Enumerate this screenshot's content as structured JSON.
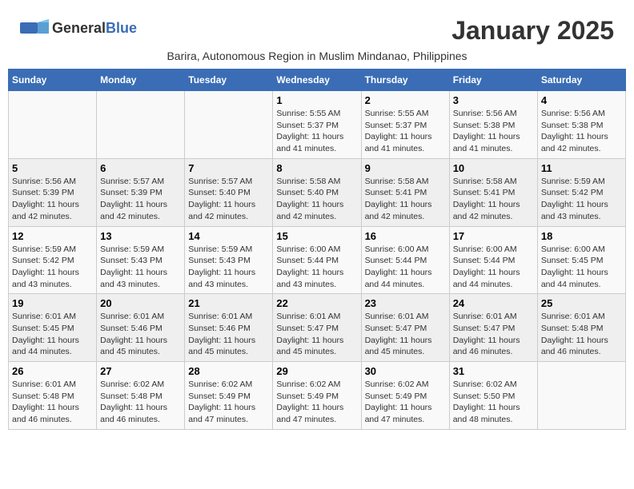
{
  "header": {
    "logo_general": "General",
    "logo_blue": "Blue",
    "month_title": "January 2025",
    "subtitle": "Barira, Autonomous Region in Muslim Mindanao, Philippines"
  },
  "weekdays": [
    "Sunday",
    "Monday",
    "Tuesday",
    "Wednesday",
    "Thursday",
    "Friday",
    "Saturday"
  ],
  "weeks": [
    [
      {
        "day": "",
        "info": ""
      },
      {
        "day": "",
        "info": ""
      },
      {
        "day": "",
        "info": ""
      },
      {
        "day": "1",
        "info": "Sunrise: 5:55 AM\nSunset: 5:37 PM\nDaylight: 11 hours\nand 41 minutes."
      },
      {
        "day": "2",
        "info": "Sunrise: 5:55 AM\nSunset: 5:37 PM\nDaylight: 11 hours\nand 41 minutes."
      },
      {
        "day": "3",
        "info": "Sunrise: 5:56 AM\nSunset: 5:38 PM\nDaylight: 11 hours\nand 41 minutes."
      },
      {
        "day": "4",
        "info": "Sunrise: 5:56 AM\nSunset: 5:38 PM\nDaylight: 11 hours\nand 42 minutes."
      }
    ],
    [
      {
        "day": "5",
        "info": "Sunrise: 5:56 AM\nSunset: 5:39 PM\nDaylight: 11 hours\nand 42 minutes."
      },
      {
        "day": "6",
        "info": "Sunrise: 5:57 AM\nSunset: 5:39 PM\nDaylight: 11 hours\nand 42 minutes."
      },
      {
        "day": "7",
        "info": "Sunrise: 5:57 AM\nSunset: 5:40 PM\nDaylight: 11 hours\nand 42 minutes."
      },
      {
        "day": "8",
        "info": "Sunrise: 5:58 AM\nSunset: 5:40 PM\nDaylight: 11 hours\nand 42 minutes."
      },
      {
        "day": "9",
        "info": "Sunrise: 5:58 AM\nSunset: 5:41 PM\nDaylight: 11 hours\nand 42 minutes."
      },
      {
        "day": "10",
        "info": "Sunrise: 5:58 AM\nSunset: 5:41 PM\nDaylight: 11 hours\nand 42 minutes."
      },
      {
        "day": "11",
        "info": "Sunrise: 5:59 AM\nSunset: 5:42 PM\nDaylight: 11 hours\nand 43 minutes."
      }
    ],
    [
      {
        "day": "12",
        "info": "Sunrise: 5:59 AM\nSunset: 5:42 PM\nDaylight: 11 hours\nand 43 minutes."
      },
      {
        "day": "13",
        "info": "Sunrise: 5:59 AM\nSunset: 5:43 PM\nDaylight: 11 hours\nand 43 minutes."
      },
      {
        "day": "14",
        "info": "Sunrise: 5:59 AM\nSunset: 5:43 PM\nDaylight: 11 hours\nand 43 minutes."
      },
      {
        "day": "15",
        "info": "Sunrise: 6:00 AM\nSunset: 5:44 PM\nDaylight: 11 hours\nand 43 minutes."
      },
      {
        "day": "16",
        "info": "Sunrise: 6:00 AM\nSunset: 5:44 PM\nDaylight: 11 hours\nand 44 minutes."
      },
      {
        "day": "17",
        "info": "Sunrise: 6:00 AM\nSunset: 5:44 PM\nDaylight: 11 hours\nand 44 minutes."
      },
      {
        "day": "18",
        "info": "Sunrise: 6:00 AM\nSunset: 5:45 PM\nDaylight: 11 hours\nand 44 minutes."
      }
    ],
    [
      {
        "day": "19",
        "info": "Sunrise: 6:01 AM\nSunset: 5:45 PM\nDaylight: 11 hours\nand 44 minutes."
      },
      {
        "day": "20",
        "info": "Sunrise: 6:01 AM\nSunset: 5:46 PM\nDaylight: 11 hours\nand 45 minutes."
      },
      {
        "day": "21",
        "info": "Sunrise: 6:01 AM\nSunset: 5:46 PM\nDaylight: 11 hours\nand 45 minutes."
      },
      {
        "day": "22",
        "info": "Sunrise: 6:01 AM\nSunset: 5:47 PM\nDaylight: 11 hours\nand 45 minutes."
      },
      {
        "day": "23",
        "info": "Sunrise: 6:01 AM\nSunset: 5:47 PM\nDaylight: 11 hours\nand 45 minutes."
      },
      {
        "day": "24",
        "info": "Sunrise: 6:01 AM\nSunset: 5:47 PM\nDaylight: 11 hours\nand 46 minutes."
      },
      {
        "day": "25",
        "info": "Sunrise: 6:01 AM\nSunset: 5:48 PM\nDaylight: 11 hours\nand 46 minutes."
      }
    ],
    [
      {
        "day": "26",
        "info": "Sunrise: 6:01 AM\nSunset: 5:48 PM\nDaylight: 11 hours\nand 46 minutes."
      },
      {
        "day": "27",
        "info": "Sunrise: 6:02 AM\nSunset: 5:48 PM\nDaylight: 11 hours\nand 46 minutes."
      },
      {
        "day": "28",
        "info": "Sunrise: 6:02 AM\nSunset: 5:49 PM\nDaylight: 11 hours\nand 47 minutes."
      },
      {
        "day": "29",
        "info": "Sunrise: 6:02 AM\nSunset: 5:49 PM\nDaylight: 11 hours\nand 47 minutes."
      },
      {
        "day": "30",
        "info": "Sunrise: 6:02 AM\nSunset: 5:49 PM\nDaylight: 11 hours\nand 47 minutes."
      },
      {
        "day": "31",
        "info": "Sunrise: 6:02 AM\nSunset: 5:50 PM\nDaylight: 11 hours\nand 48 minutes."
      },
      {
        "day": "",
        "info": ""
      }
    ]
  ]
}
